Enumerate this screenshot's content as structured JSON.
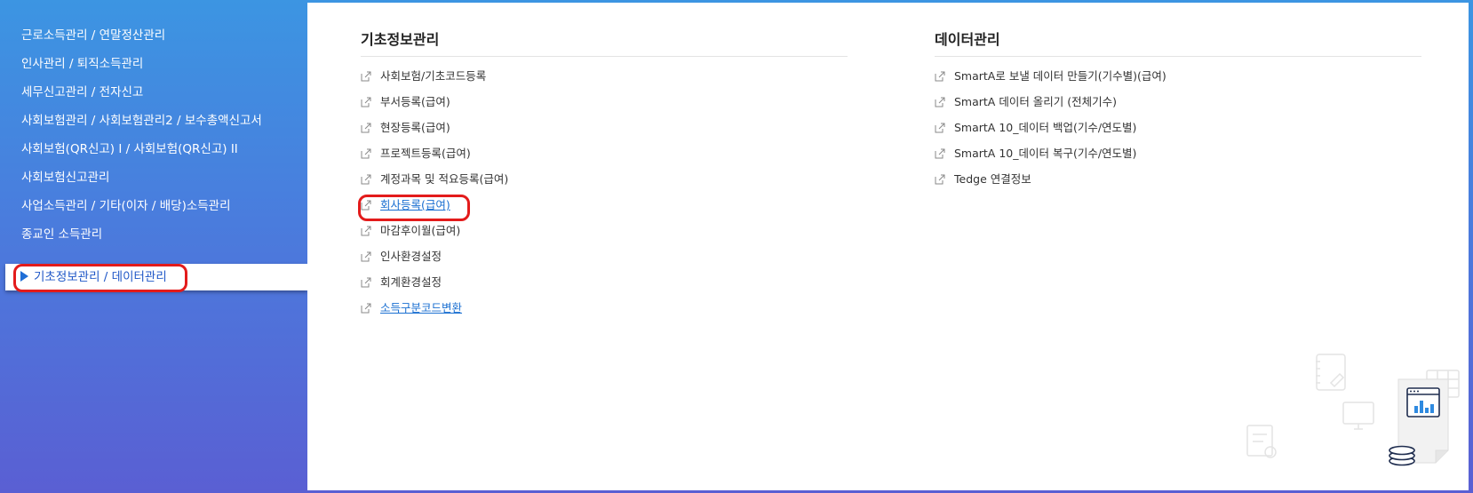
{
  "sidebar": {
    "items": [
      {
        "label": "근로소득관리 / 연말정산관리"
      },
      {
        "label": "인사관리 / 퇴직소득관리"
      },
      {
        "label": "세무신고관리 / 전자신고"
      },
      {
        "label": "사회보험관리 / 사회보험관리2 / 보수총액신고서"
      },
      {
        "label": "사회보험(QR신고) I  / 사회보험(QR신고) II"
      },
      {
        "label": "사회보험신고관리"
      },
      {
        "label": "사업소득관리 / 기타(이자 / 배당)소득관리"
      },
      {
        "label": "종교인 소득관리"
      },
      {
        "label": "기초정보관리 / 데이터관리",
        "active": true
      }
    ]
  },
  "basic_info": {
    "title": "기초정보관리",
    "items": [
      {
        "label": "사회보험/기초코드등록"
      },
      {
        "label": "부서등록(급여)"
      },
      {
        "label": "현장등록(급여)"
      },
      {
        "label": "프로젝트등록(급여)"
      },
      {
        "label": "계정과목 및 적요등록(급여)"
      },
      {
        "label": "회사등록(급여)",
        "link": true
      },
      {
        "label": "마감후이월(급여)"
      },
      {
        "label": "인사환경설정"
      },
      {
        "label": "회계환경설정"
      },
      {
        "label": "소득구분코드변환",
        "link": true
      }
    ]
  },
  "data_mgmt": {
    "title": "데이터관리",
    "items": [
      {
        "label": "SmartA로 보낼 데이터 만들기(기수별)(급여)"
      },
      {
        "label": "SmartA 데이터 올리기 (전체기수)"
      },
      {
        "label": "SmartA 10_데이터 백업(기수/연도별)"
      },
      {
        "label": "SmartA 10_데이터 복구(기수/연도별)"
      },
      {
        "label": "Tedge 연결정보"
      }
    ]
  },
  "colors": {
    "sidebar_top": "#3c95e2",
    "sidebar_bottom": "#5a5fd3",
    "active_text": "#1f57c7",
    "link": "#1a6fd1",
    "highlight_ring": "#e31b1b"
  },
  "icons": {
    "menu_item": "external-link-icon",
    "active_marker": "triangle-right-icon"
  }
}
